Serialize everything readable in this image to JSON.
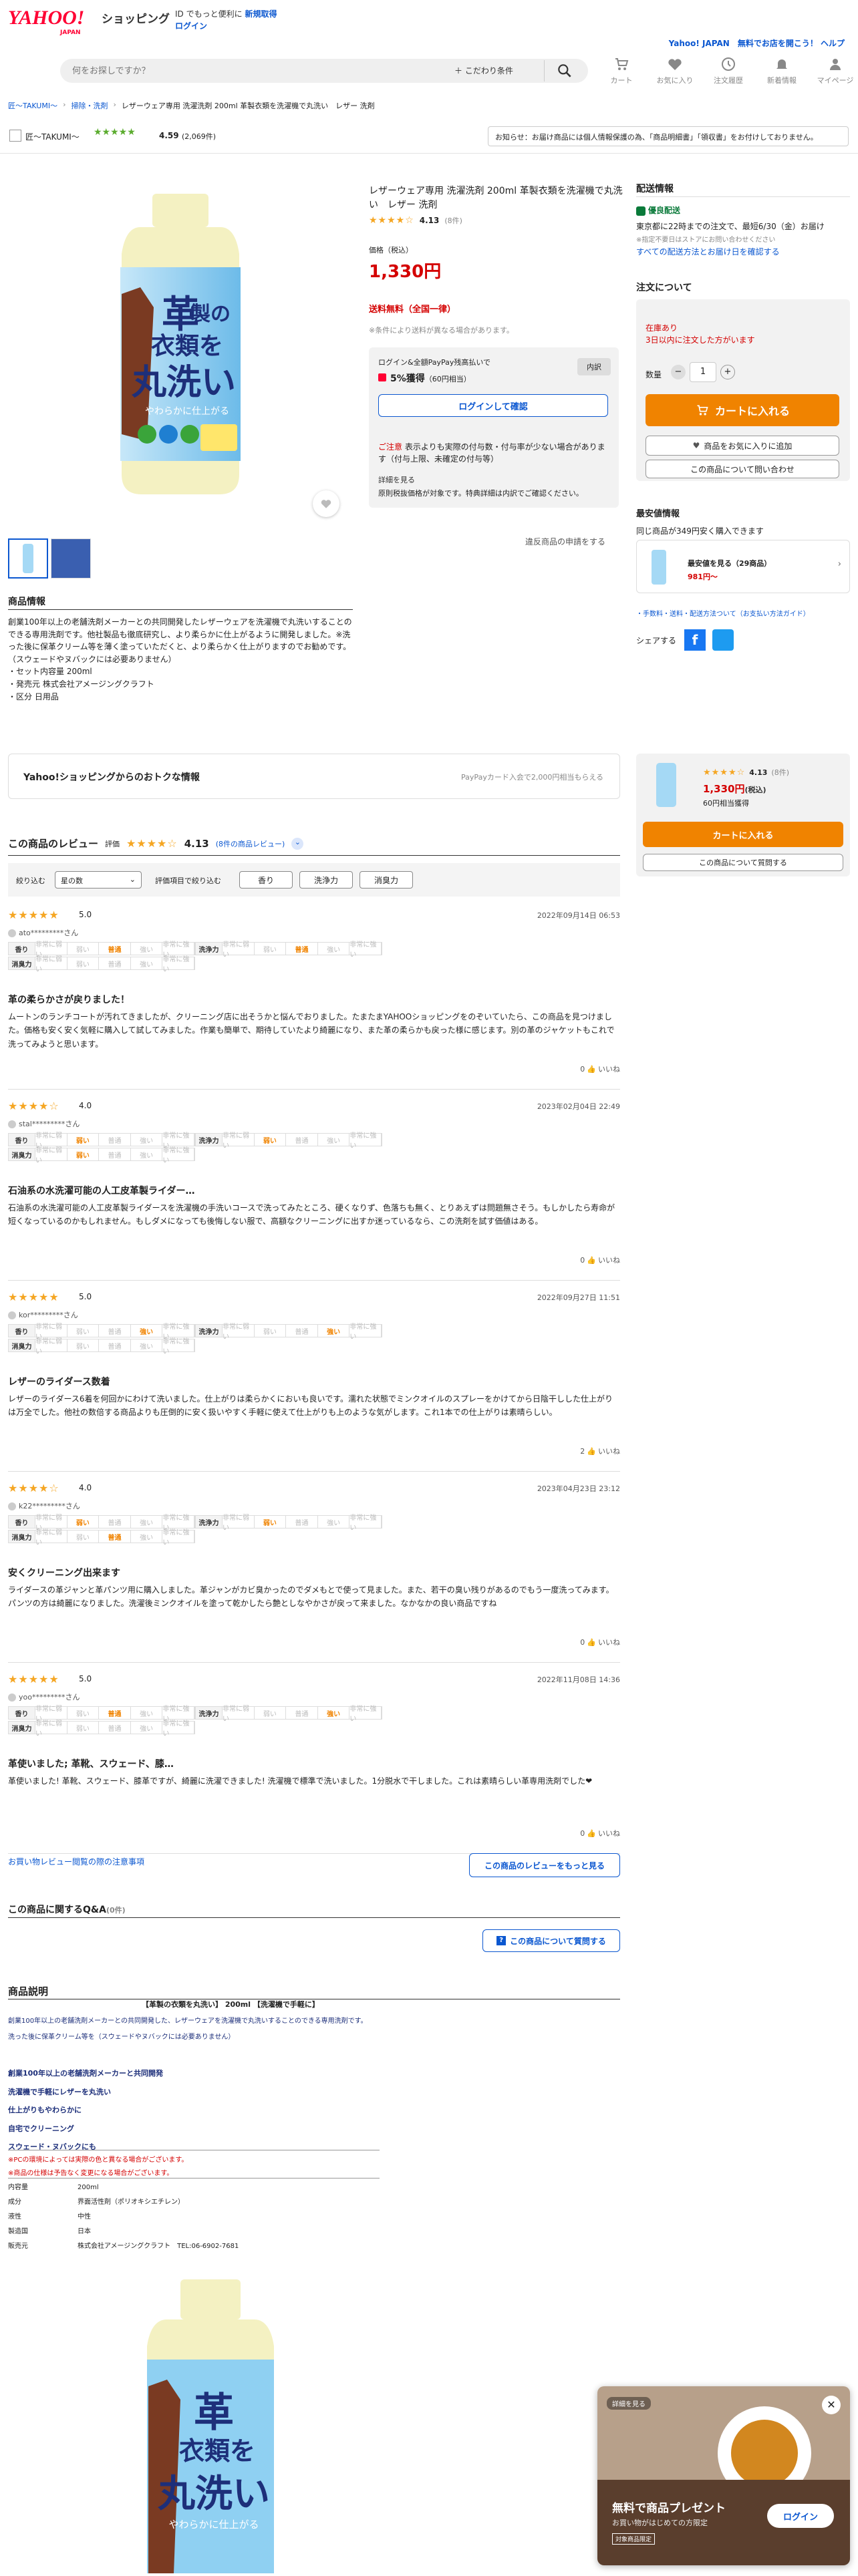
{
  "header": {
    "logo": "YAHOO!",
    "logo_sub": "JAPAN",
    "service": "ショッピング",
    "tagline": "ID でもっと便利に",
    "register": "新規取得",
    "login": "ログイン",
    "promo": "Yahoo! JAPAN　無料でお店を開こう！ ヘルプ",
    "search_placeholder": "何をお探しですか？",
    "filter": "＋ こだわり条件",
    "icons": [
      "カート",
      "お気に入り",
      "注文履歴",
      "新着情報",
      "マイページ"
    ]
  },
  "breadcrumb": [
    "匠〜TAKUMI〜",
    "掃除・洗剤",
    "レザーウェア専用 洗濯洗剤 200ml 革製衣類を洗濯機で丸洗い　レザー 洗剤"
  ],
  "store": {
    "name": "匠〜TAKUMI〜",
    "rating": "4.59",
    "count": "(2,069件)",
    "notice": "お知らせ：お届け商品には個人情報保護の為、「商品明細書」「領収書」をお付けしておりません。"
  },
  "product": {
    "title": "レザーウェア専用 洗濯洗剤 200ml 革製衣類を洗濯機で丸洗い　レザー 洗剤",
    "rating": "4.13",
    "rating_count": "(8件)",
    "price_label": "価格（税込）",
    "price": "1,330円",
    "shipping": "送料無料（全国一律）",
    "shipping_note": "※条件により送料が異なる場合があります。",
    "points_label": "ログイン&全額PayPay残高払いで",
    "points": "5%獲得",
    "points_yen": "（60円相当）",
    "points_breakdown": "内訳",
    "login_confirm": "ログインして確認",
    "caution_title": "ご注意",
    "caution": "表示よりも実際の付与数・付与率が少ない場合があります（付与上限、未確定の付与等）",
    "caution_more": "詳細を見る",
    "caution_note": "原則税抜価格が対象です。特典詳細は内訳でご確認ください。",
    "report": "違反商品の申請をする",
    "bottle_lines": [
      "革",
      "製の",
      "衣類を",
      "丸洗い",
      "やわらかに仕上がる"
    ]
  },
  "delivery": {
    "title": "配送情報",
    "badge": "優良配送",
    "text": "東京都に22時までの注文で、最短6/30（金）お届け",
    "note": "※指定不要日はストアにお問い合わせください",
    "link": "すべての配送方法とお届け日を確認する"
  },
  "order": {
    "title": "注文について",
    "stock": "在庫あり",
    "stock_note": "3日以内に注文した方がいます",
    "qty_label": "数量",
    "qty": "1",
    "cart": "カートに入れる",
    "fav": "商品をお気に入りに追加",
    "ask": "この商品について問い合わせ"
  },
  "cheapest": {
    "title": "最安値情報",
    "text": "同じ商品が349円安く購入できます",
    "item_label": "最安値を見る（29商品）",
    "item_price": "981円〜",
    "links": "・手数料・送料・配送方法ついて（お支払い方法ガイド）",
    "share": "シェアする"
  },
  "info": {
    "title": "商品情報",
    "text": [
      "創業100年以上の老舗洗剤メーカーとの共同開発したレザーウェアを洗濯機で丸洗いすることのできる専用洗剤です。他社製品も徹底研究し、より柔らかに仕上がるように開発しました。※洗った後に保革クリーム等を薄く塗っていただくと、より柔らかく仕上がりますのでお勧めです。（スウェードやヌバックには必要ありません）",
      "・セット内容量 200ml",
      "・発売元 株式会社アメージングクラフト",
      "・区分 日用品"
    ]
  },
  "deal": {
    "title": "Yahoo!ショッピングからのおトクな情報",
    "right": "PayPayカード入会で2,000円相当もらえる"
  },
  "sticky": {
    "rating": "4.13",
    "count": "(8件)",
    "price": "1,330円",
    "price_sub": "(税込)",
    "points": "60円相当獲得",
    "cart": "カートに入れる",
    "ask": "この商品について質問する"
  },
  "reviews": {
    "title": "この商品のレビュー",
    "label": "評価",
    "rating": "4.13",
    "count_link": "(8件の商品レビュー)",
    "filter_label": "絞り込む",
    "sort_value": "星の数",
    "filter2": "評価項目で絞り込む",
    "chips": [
      "香り",
      "洗浄力",
      "消臭力"
    ],
    "items": [
      {
        "stars": "★★★★★",
        "score": "5.0",
        "date": "2022年09月14日 06:53",
        "user": "ato*********さん",
        "aroma": 2,
        "power": 2,
        "deo": -1,
        "title": "革の柔らかさが戻りました！",
        "body": "ムートンのランチコートが汚れてきましたが、クリーニング店に出そうかと悩んでおりました。たまたまYAHOOショッピングをのぞいていたら、この商品を見つけました。価格も安く安く気軽に購入して試してみました。作業も簡単で、期待していたより綺麗になり、また革の柔らかも戻った様に感じます。別の革のジャケットもこれで洗ってみようと思います。",
        "helpful": "0",
        "helpful_label": "いいね"
      },
      {
        "stars": "★★★★☆",
        "score": "4.0",
        "date": "2023年02月04日 22:49",
        "user": "stal*********さん",
        "aroma": 1,
        "power": 1,
        "deo": 1,
        "title": "石油系の水洗濯可能の人工皮革製ライダー…",
        "body": "石油系の水洗濯可能の人工皮革製ライダースを洗濯機の手洗いコースで洗ってみたところ、硬くなりず、色落ちも無く、とりあえずは問題無さそう。もしかしたら寿命が短くなっているのかもしれません。もしダメになっても後悔しない服で、高額なクリーニングに出すか迷っているなら、この洗剤を試す価値はある。",
        "helpful": "0",
        "helpful_label": "いいね"
      },
      {
        "stars": "★★★★★",
        "score": "5.0",
        "date": "2022年09月27日 11:51",
        "user": "kor*********さん",
        "aroma": 3,
        "power": 3,
        "deo": -1,
        "title": "レザーのライダース数着",
        "body": "レザーのライダース6着を何回かにわけて洗いました。仕上がりは柔らかくにおいも良いです。濡れた状態でミンクオイルのスプレーをかけてから日陰干しした仕上がりは万全でした。他社の数倍する商品よりも圧倒的に安く扱いやすく手軽に使えて仕上がりも上のような気がします。これ1本での仕上がりは素晴らしい。",
        "helpful": "2",
        "helpful_label": "いいね"
      },
      {
        "stars": "★★★★☆",
        "score": "4.0",
        "date": "2023年04月23日 23:12",
        "user": "k22*********さん",
        "aroma": 1,
        "power": 1,
        "deo": 2,
        "title": "安くクリーニング出来ます",
        "body": "ライダースの革ジャンと革パンツ用に購入しました。革ジャンがカビ臭かったのでダメもとで使って見ました。また、若干の臭い残りがあるのでもう一度洗ってみます。パンツの方は綺麗になりました。洗濯後ミンクオイルを塗って乾かしたら艶としなやかさが戻って来ました。なかなかの良い商品ですね",
        "helpful": "0",
        "helpful_label": "いいね"
      },
      {
        "stars": "★★★★★",
        "score": "5.0",
        "date": "2022年11月08日 14:36",
        "user": "yoo*********さん",
        "aroma": 2,
        "power": 3,
        "deo": -1,
        "title": "革使いました; 革靴、スウェード、膝…",
        "body": "革使いました! 革靴、スウェード、膝革ですが、綺麗に洗濯できました! 洗濯機で標準で洗いました。1分脱水で干しました。これは素晴らしい革専用洗剤でした❤",
        "helpful": "0",
        "helpful_label": "いいね"
      }
    ],
    "scale_labels": [
      "非常に弱い",
      "弱い",
      "普通",
      "強い",
      "非常に強い"
    ],
    "row_aroma": "香り",
    "row_power": "洗浄力",
    "row_deo": "消臭力",
    "more": "この商品のレビューをもっと見る",
    "notes": "お買い物レビュー閲覧の際の注意事項"
  },
  "qa": {
    "title": "この商品に関するQ&A",
    "count": "(0件)",
    "ask": "この商品について質問する"
  },
  "desc": {
    "title": "商品説明",
    "line1": "【革製の衣類を丸洗い】 200ml 【洗濯機で手軽に】",
    "line2": "創業100年以上の老舗洗剤メーカーとの共同開発した、レザーウェアを洗濯機で丸洗いすることのできる専用洗剤です。",
    "line3": "洗った後に保革クリーム等を（スウェードやヌバックには必要ありません）",
    "bullets": [
      "創業100年以上の老舗洗剤メーカーと共同開発",
      "洗濯機で手軽にレザーを丸洗い",
      "仕上がりもやわらかに",
      "自宅でクリーニング",
      "スウェード・ヌバックにも"
    ],
    "warn1": "※PCの環境によっては実際の色と異なる場合がございます。",
    "warn2": "※商品の仕様は予告なく変更になる場合がございます。",
    "specs": [
      [
        "内容量",
        "200ml"
      ],
      [
        "成分",
        "界面活性剤（ポリオキシエチレン）"
      ],
      [
        "液性",
        "中性"
      ],
      [
        "製造国",
        "日本"
      ],
      [
        "販売元",
        "株式会社アメージングクラフト　TEL:06-6902-7681"
      ]
    ]
  },
  "popup": {
    "tag": "詳細を見る",
    "title": "無料で商品プレゼント",
    "sub": "お買い物がはじめての方限定",
    "badge": "対象商品限定",
    "login": "ログイン"
  }
}
